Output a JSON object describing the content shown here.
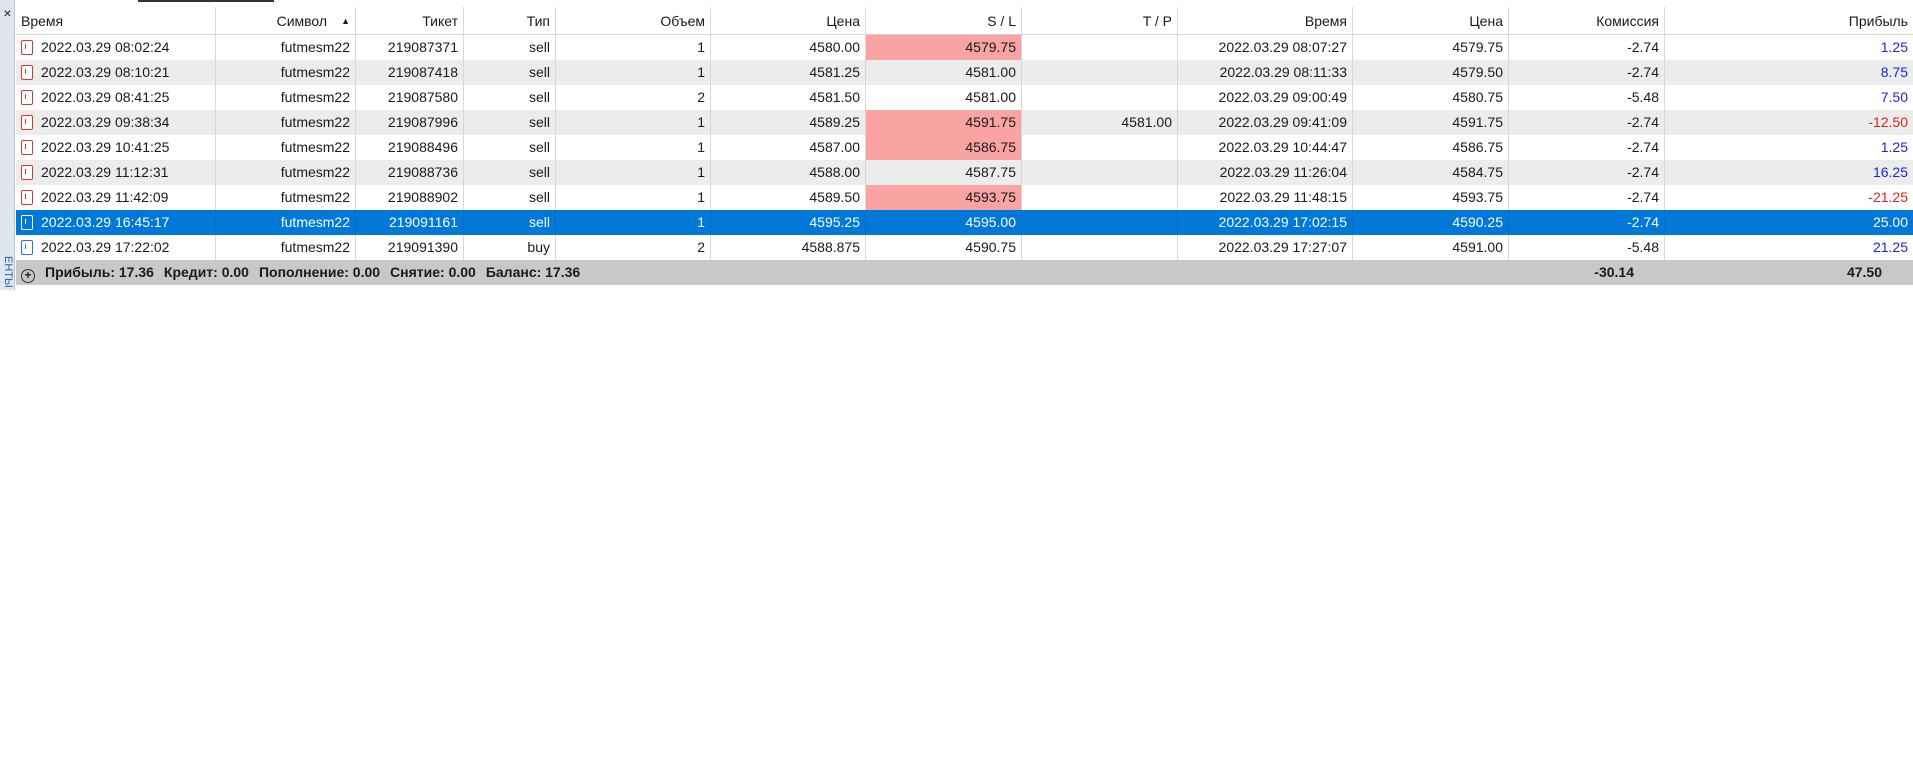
{
  "side_tab_label": "ЕНТЫ",
  "close_glyph": "×",
  "columns": [
    "Время",
    "Символ",
    "Тикет",
    "Тип",
    "Объем",
    "Цена",
    "S / L",
    "T / P",
    "Время",
    "Цена",
    "Комиссия",
    "Прибыль"
  ],
  "sort_indicator": "▲",
  "rows": [
    {
      "open_time": "2022.03.29 08:02:24",
      "symbol": "futmesm22",
      "ticket": "219087371",
      "type": "sell",
      "volume": "1",
      "open_price": "4580.00",
      "sl": "4579.75",
      "tp": "",
      "close_time": "2022.03.29 08:07:27",
      "close_price": "4579.75",
      "commission": "-2.74",
      "profit": "1.25"
    },
    {
      "open_time": "2022.03.29 08:10:21",
      "symbol": "futmesm22",
      "ticket": "219087418",
      "type": "sell",
      "volume": "1",
      "open_price": "4581.25",
      "sl": "4581.00",
      "tp": "",
      "close_time": "2022.03.29 08:11:33",
      "close_price": "4579.50",
      "commission": "-2.74",
      "profit": "8.75"
    },
    {
      "open_time": "2022.03.29 08:41:25",
      "symbol": "futmesm22",
      "ticket": "219087580",
      "type": "sell",
      "volume": "2",
      "open_price": "4581.50",
      "sl": "4581.00",
      "tp": "",
      "close_time": "2022.03.29 09:00:49",
      "close_price": "4580.75",
      "commission": "-5.48",
      "profit": "7.50"
    },
    {
      "open_time": "2022.03.29 09:38:34",
      "symbol": "futmesm22",
      "ticket": "219087996",
      "type": "sell",
      "volume": "1",
      "open_price": "4589.25",
      "sl": "4591.75",
      "tp": "4581.00",
      "close_time": "2022.03.29 09:41:09",
      "close_price": "4591.75",
      "commission": "-2.74",
      "profit": "-12.50"
    },
    {
      "open_time": "2022.03.29 10:41:25",
      "symbol": "futmesm22",
      "ticket": "219088496",
      "type": "sell",
      "volume": "1",
      "open_price": "4587.00",
      "sl": "4586.75",
      "tp": "",
      "close_time": "2022.03.29 10:44:47",
      "close_price": "4586.75",
      "commission": "-2.74",
      "profit": "1.25"
    },
    {
      "open_time": "2022.03.29 11:12:31",
      "symbol": "futmesm22",
      "ticket": "219088736",
      "type": "sell",
      "volume": "1",
      "open_price": "4588.00",
      "sl": "4587.75",
      "tp": "",
      "close_time": "2022.03.29 11:26:04",
      "close_price": "4584.75",
      "commission": "-2.74",
      "profit": "16.25"
    },
    {
      "open_time": "2022.03.29 11:42:09",
      "symbol": "futmesm22",
      "ticket": "219088902",
      "type": "sell",
      "volume": "1",
      "open_price": "4589.50",
      "sl": "4593.75",
      "tp": "",
      "close_time": "2022.03.29 11:48:15",
      "close_price": "4593.75",
      "commission": "-2.74",
      "profit": "-21.25"
    },
    {
      "open_time": "2022.03.29 16:45:17",
      "symbol": "futmesm22",
      "ticket": "219091161",
      "type": "sell",
      "volume": "1",
      "open_price": "4595.25",
      "sl": "4595.00",
      "tp": "",
      "close_time": "2022.03.29 17:02:15",
      "close_price": "4590.25",
      "commission": "-2.74",
      "profit": "25.00"
    },
    {
      "open_time": "2022.03.29 17:22:02",
      "symbol": "futmesm22",
      "ticket": "219091390",
      "type": "buy",
      "volume": "2",
      "open_price": "4588.875",
      "sl": "4590.75",
      "tp": "",
      "close_time": "2022.03.29 17:27:07",
      "close_price": "4591.00",
      "commission": "-5.48",
      "profit": "21.25"
    }
  ],
  "sl_highlight_rows": [
    0,
    3,
    4,
    6
  ],
  "selected_row": 7,
  "summary": {
    "expand_glyph": "+",
    "profit": "Прибыль: 17.36",
    "credit": "Кредит: 0.00",
    "deposit": "Пополнение: 0.00",
    "withdrawal": "Снятие: 0.00",
    "balance": "Баланс: 17.36",
    "total_commission": "-30.14",
    "total_profit": "47.50"
  },
  "colors": {
    "selected_row": "#0078d7",
    "sl_highlight": "#f9a3a3",
    "profit_positive": "#2222dd",
    "profit_negative": "#e02020",
    "summary_bar": "#c8c8c8"
  }
}
